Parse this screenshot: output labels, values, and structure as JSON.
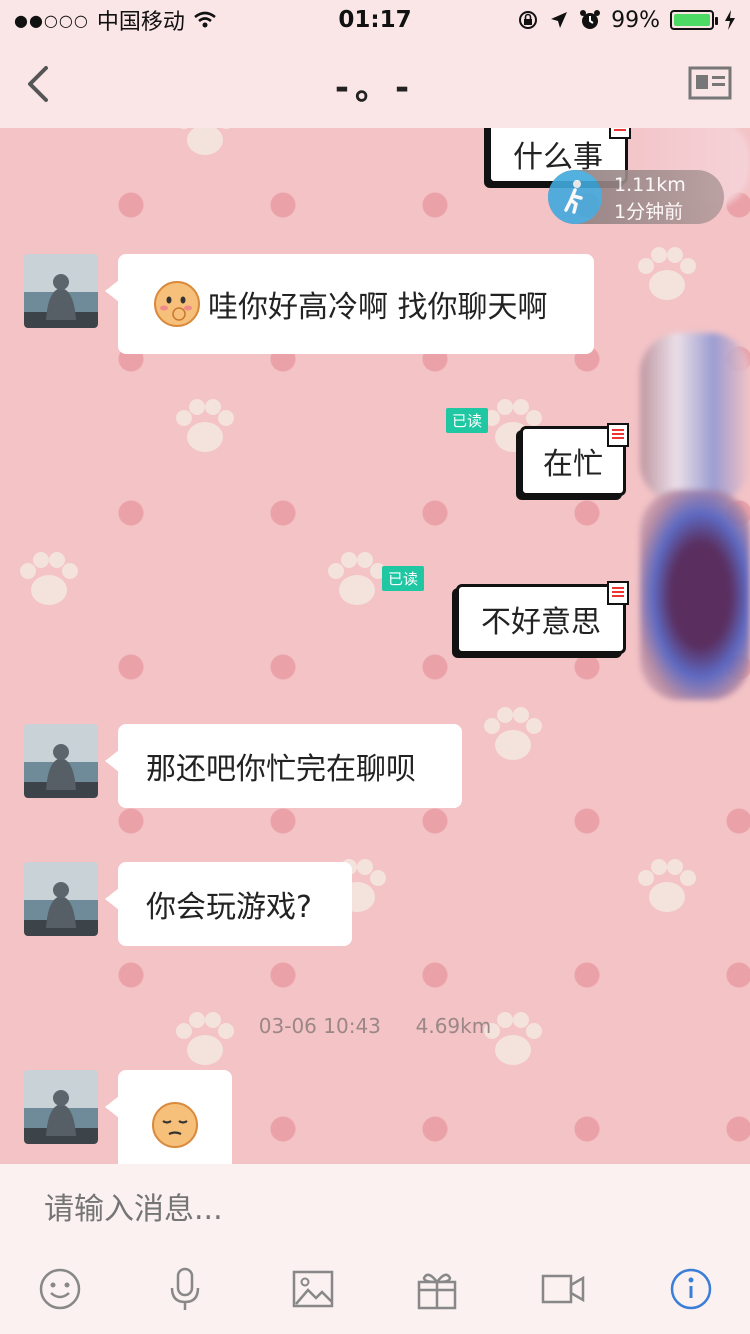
{
  "status": {
    "carrier": "中国移动",
    "signal": "●●○○○",
    "time": "01:17",
    "battery": "99%",
    "battery_level": 0.99
  },
  "nav": {
    "title": "-。-"
  },
  "messages": {
    "top_out": "什么事",
    "top_distance": "1.11km",
    "top_time": "1分钟前",
    "m1": "哇你好高冷啊 找你聊天啊",
    "m2": "在忙",
    "m2_read": "已读",
    "m3": "不好意思",
    "m3_read": "已读",
    "m4": "那还吧你忙完在聊呗",
    "m5": "你会玩游戏?",
    "timestamp": "03-06 10:43",
    "timestamp_distance": "4.69km"
  },
  "input": {
    "placeholder": "请输入消息..."
  },
  "colors": {
    "background": "#f3c3c6",
    "read_badge": "#1fc7a3",
    "location_icon": "#41a9dd"
  }
}
